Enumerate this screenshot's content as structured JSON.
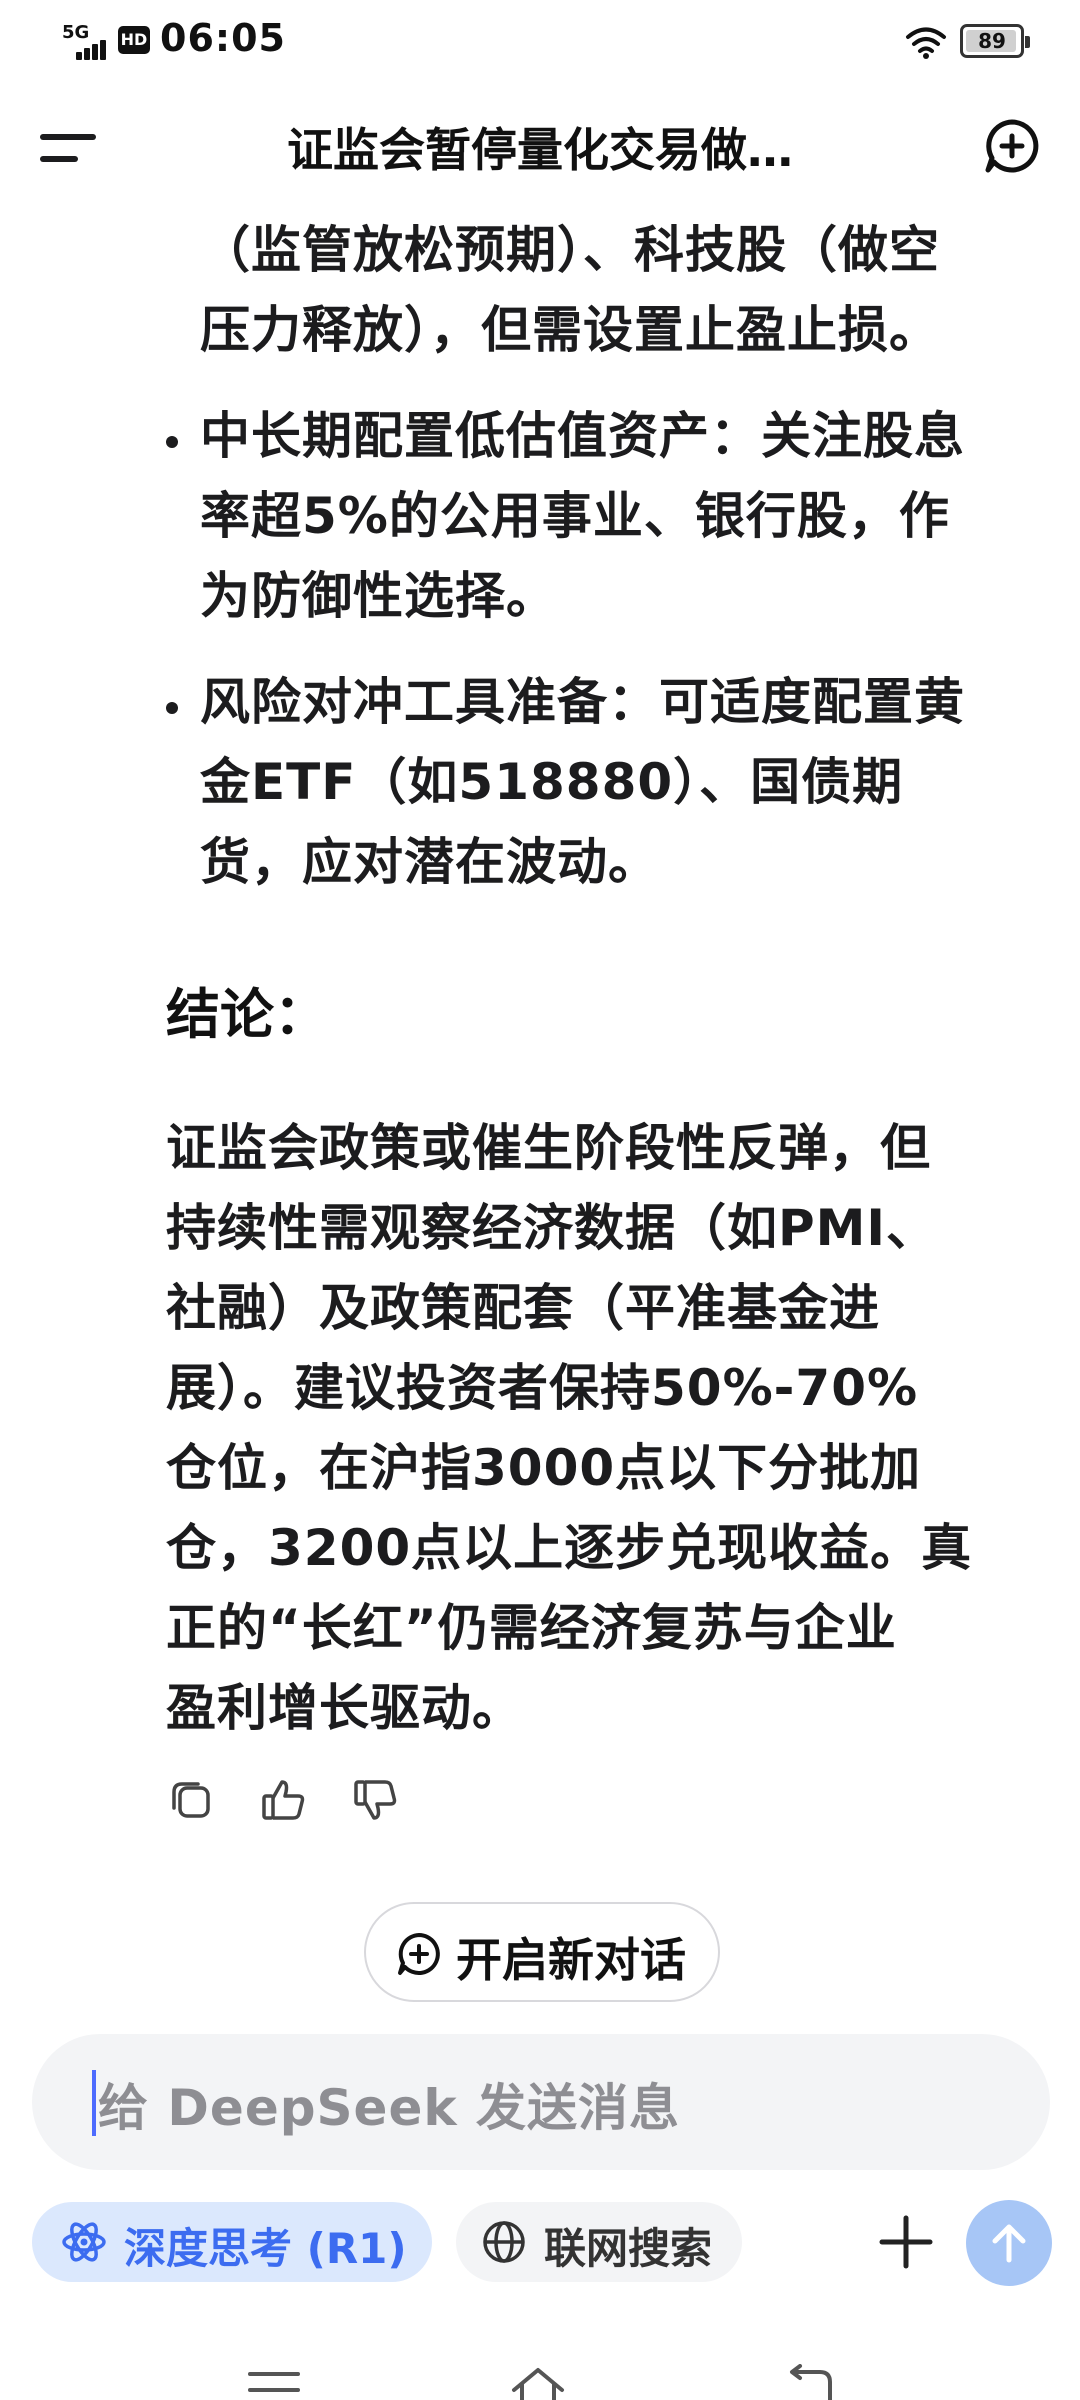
{
  "status_bar": {
    "network": "5G",
    "hd": "HD",
    "time": "06:05",
    "battery": "89"
  },
  "topbar": {
    "title": "证监会暂停量化交易做…"
  },
  "article": {
    "intro_line1": "（监管放松预期）、科技股（做空",
    "intro_line2": "压力释放），但需设置止盈止损。",
    "bullet1_bold": "中长期配置低估值资产",
    "bullet1_colon": "：",
    "bullet1_rest1": "关注股息",
    "bullet1_line2": "率超5%的公用事业、银行股，作",
    "bullet1_line3": "为防御性选择。",
    "bullet2_bold": "风险对冲工具准备",
    "bullet2_colon": "：",
    "bullet2_rest1": "可适度配置黄",
    "bullet2_line2": "金ETF（如518880）、国债期",
    "bullet2_line3": "货，应对潜在波动。",
    "heading": "结论：",
    "conclusion_lines": [
      "证监会政策或催生阶段性反弹，但",
      "持续性需观察经济数据（如PMI、",
      "社融）及政策配套（平准基金进",
      "展）。建议投资者保持50%-70%",
      "仓位，在沪指3000点以下分批加",
      "仓，3200点以上逐步兑现收益。真",
      "正的“长红”仍需经济复苏与企业",
      "盈利增长驱动。"
    ]
  },
  "actions": {
    "new_chat_label": "开启新对话"
  },
  "composer": {
    "placeholder": "给 DeepSeek 发送消息",
    "deep_think_label": "深度思考 (R1)",
    "web_search_label": "联网搜索"
  },
  "colors": {
    "accent": "#4d6bfe",
    "chip_active_bg": "#dbe8fd",
    "chip_active_text": "#3c6cf0",
    "send_bg": "#a7c6f6"
  }
}
